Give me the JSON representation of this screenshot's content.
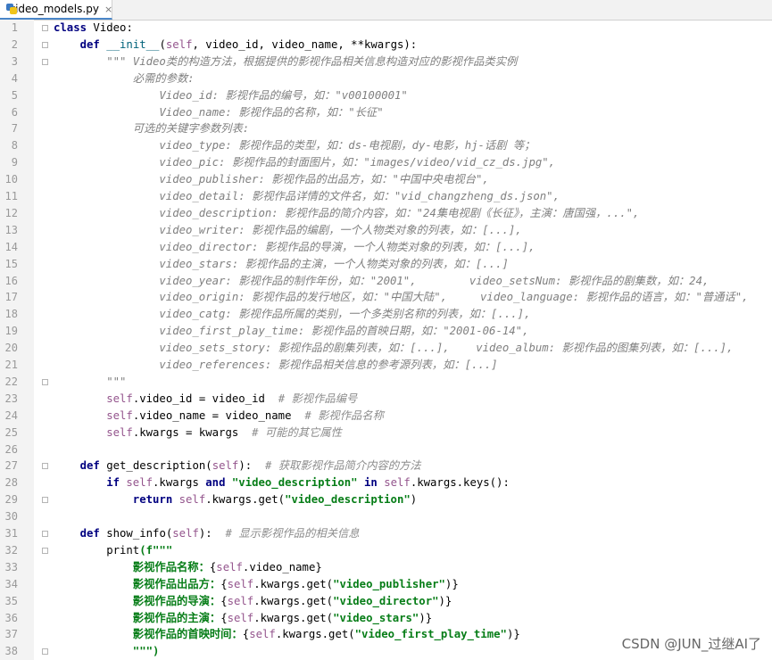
{
  "tab": {
    "filename": "video_models.py",
    "icon": "python-file-icon",
    "close": "×"
  },
  "lines": [
    {
      "n": "1",
      "indent": 0,
      "tokens": [
        {
          "t": "class ",
          "c": "kw"
        },
        {
          "t": "Video:",
          "c": ""
        }
      ]
    },
    {
      "n": "2",
      "indent": 4,
      "tokens": [
        {
          "t": "def ",
          "c": "kw"
        },
        {
          "t": "__init__",
          "c": "fn"
        },
        {
          "t": "(",
          "c": ""
        },
        {
          "t": "self",
          "c": "self"
        },
        {
          "t": ", video_id, video_name, **kwargs):",
          "c": ""
        }
      ]
    },
    {
      "n": "3",
      "indent": 8,
      "tokens": [
        {
          "t": "\"\"\" Video类的构造方法，根据提供的影视作品相关信息构造对应的影视作品类实例",
          "c": "doc"
        }
      ]
    },
    {
      "n": "4",
      "indent": 12,
      "tokens": [
        {
          "t": "必需的参数:",
          "c": "doc"
        }
      ]
    },
    {
      "n": "5",
      "indent": 16,
      "tokens": [
        {
          "t": "Video_id: 影视作品的编号，如：\"v00100001\"",
          "c": "doc"
        }
      ]
    },
    {
      "n": "6",
      "indent": 16,
      "tokens": [
        {
          "t": "Video_name: 影视作品的名称，如：\"长征\"",
          "c": "doc"
        }
      ]
    },
    {
      "n": "7",
      "indent": 12,
      "tokens": [
        {
          "t": "可选的关键字参数列表:",
          "c": "doc"
        }
      ]
    },
    {
      "n": "8",
      "indent": 16,
      "tokens": [
        {
          "t": "video_type: 影视作品的类型，如：ds-电视剧，dy-电影，hj-话剧 等；",
          "c": "doc"
        }
      ]
    },
    {
      "n": "9",
      "indent": 16,
      "tokens": [
        {
          "t": "video_pic: 影视作品的封面图片，如：\"images/video/vid_cz_ds.jpg\",",
          "c": "doc"
        }
      ]
    },
    {
      "n": "10",
      "indent": 16,
      "tokens": [
        {
          "t": "video_publisher: 影视作品的出品方，如：\"中国中央电视台\",",
          "c": "doc"
        }
      ]
    },
    {
      "n": "11",
      "indent": 16,
      "tokens": [
        {
          "t": "video_detail: 影视作品详情的文件名，如：\"vid_changzheng_ds.json\",",
          "c": "doc"
        }
      ]
    },
    {
      "n": "12",
      "indent": 16,
      "tokens": [
        {
          "t": "video_description: 影视作品的简介内容，如：\"24集电视剧《长征》，主演：唐国强，...\",",
          "c": "doc"
        }
      ]
    },
    {
      "n": "13",
      "indent": 16,
      "tokens": [
        {
          "t": "video_writer: 影视作品的编剧，一个人物类对象的列表，如：[...],",
          "c": "doc"
        }
      ]
    },
    {
      "n": "14",
      "indent": 16,
      "tokens": [
        {
          "t": "video_director: 影视作品的导演，一个人物类对象的列表，如：[...],",
          "c": "doc"
        }
      ]
    },
    {
      "n": "15",
      "indent": 16,
      "tokens": [
        {
          "t": "video_stars: 影视作品的主演，一个人物类对象的列表，如：[...]",
          "c": "doc"
        }
      ]
    },
    {
      "n": "16",
      "indent": 16,
      "tokens": [
        {
          "t": "video_year: 影视作品的制作年份，如：\"2001\",        video_setsNum: 影视作品的剧集数，如：24,",
          "c": "doc"
        }
      ]
    },
    {
      "n": "17",
      "indent": 16,
      "tokens": [
        {
          "t": "video_origin: 影视作品的发行地区，如：\"中国大陆\",     video_language: 影视作品的语言，如：\"普通话\",",
          "c": "doc"
        }
      ]
    },
    {
      "n": "18",
      "indent": 16,
      "tokens": [
        {
          "t": "video_catg: 影视作品所属的类别，一个多类别名称的列表，如：[...],",
          "c": "doc"
        }
      ]
    },
    {
      "n": "19",
      "indent": 16,
      "tokens": [
        {
          "t": "video_first_play_time: 影视作品的首映日期，如：\"2001-06-14\",",
          "c": "doc"
        }
      ]
    },
    {
      "n": "20",
      "indent": 16,
      "tokens": [
        {
          "t": "video_sets_story: 影视作品的剧集列表，如：[...],    video_album: 影视作品的图集列表，如：[...],",
          "c": "doc"
        }
      ]
    },
    {
      "n": "21",
      "indent": 16,
      "tokens": [
        {
          "t": "video_references: 影视作品相关信息的参考源列表，如：[...]",
          "c": "doc"
        }
      ]
    },
    {
      "n": "22",
      "indent": 8,
      "tokens": [
        {
          "t": "\"\"\"",
          "c": "doc"
        }
      ]
    },
    {
      "n": "23",
      "indent": 8,
      "tokens": [
        {
          "t": "self",
          "c": "self"
        },
        {
          "t": ".video_id = video_id  ",
          "c": ""
        },
        {
          "t": "# 影视作品编号",
          "c": "cmt"
        }
      ]
    },
    {
      "n": "24",
      "indent": 8,
      "tokens": [
        {
          "t": "self",
          "c": "self"
        },
        {
          "t": ".video_name = video_name  ",
          "c": ""
        },
        {
          "t": "# 影视作品名称",
          "c": "cmt"
        }
      ]
    },
    {
      "n": "25",
      "indent": 8,
      "tokens": [
        {
          "t": "self",
          "c": "self"
        },
        {
          "t": ".kwargs = kwargs  ",
          "c": ""
        },
        {
          "t": "# 可能的其它属性",
          "c": "cmt"
        }
      ]
    },
    {
      "n": "26",
      "indent": 0,
      "tokens": []
    },
    {
      "n": "27",
      "indent": 4,
      "tokens": [
        {
          "t": "def ",
          "c": "kw"
        },
        {
          "t": "get_description",
          "c": ""
        },
        {
          "t": "(",
          "c": ""
        },
        {
          "t": "self",
          "c": "self"
        },
        {
          "t": "):  ",
          "c": ""
        },
        {
          "t": "# 获取影视作品简介内容的方法",
          "c": "cmt"
        }
      ]
    },
    {
      "n": "28",
      "indent": 8,
      "tokens": [
        {
          "t": "if ",
          "c": "kw"
        },
        {
          "t": "self",
          "c": "self"
        },
        {
          "t": ".kwargs ",
          "c": ""
        },
        {
          "t": "and ",
          "c": "kw"
        },
        {
          "t": "\"video_description\"",
          "c": "str"
        },
        {
          "t": " in ",
          "c": "kw"
        },
        {
          "t": "self",
          "c": "self"
        },
        {
          "t": ".kwargs.keys():",
          "c": ""
        }
      ]
    },
    {
      "n": "29",
      "indent": 12,
      "tokens": [
        {
          "t": "return ",
          "c": "kw"
        },
        {
          "t": "self",
          "c": "self"
        },
        {
          "t": ".kwargs.get(",
          "c": ""
        },
        {
          "t": "\"video_description\"",
          "c": "str"
        },
        {
          "t": ")",
          "c": ""
        }
      ]
    },
    {
      "n": "30",
      "indent": 0,
      "tokens": []
    },
    {
      "n": "31",
      "indent": 4,
      "tokens": [
        {
          "t": "def ",
          "c": "kw"
        },
        {
          "t": "show_info",
          "c": ""
        },
        {
          "t": "(",
          "c": ""
        },
        {
          "t": "self",
          "c": "self"
        },
        {
          "t": "):  ",
          "c": ""
        },
        {
          "t": "# 显示影视作品的相关信息",
          "c": "cmt"
        }
      ]
    },
    {
      "n": "32",
      "indent": 8,
      "tokens": [
        {
          "t": "print",
          "c": ""
        },
        {
          "t": "(f\"\"\"",
          "c": "str"
        }
      ]
    },
    {
      "n": "33",
      "indent": 12,
      "tokens": [
        {
          "t": "影视作品名称：",
          "c": "str"
        },
        {
          "t": "{",
          "c": ""
        },
        {
          "t": "self",
          "c": "self"
        },
        {
          "t": ".video_name}",
          "c": ""
        }
      ]
    },
    {
      "n": "34",
      "indent": 12,
      "tokens": [
        {
          "t": "影视作品出品方：",
          "c": "str"
        },
        {
          "t": "{",
          "c": ""
        },
        {
          "t": "self",
          "c": "self"
        },
        {
          "t": ".kwargs.get(",
          "c": ""
        },
        {
          "t": "\"video_publisher\"",
          "c": "str"
        },
        {
          "t": ")}",
          "c": ""
        }
      ]
    },
    {
      "n": "35",
      "indent": 12,
      "tokens": [
        {
          "t": "影视作品的导演：",
          "c": "str"
        },
        {
          "t": "{",
          "c": ""
        },
        {
          "t": "self",
          "c": "self"
        },
        {
          "t": ".kwargs.get(",
          "c": ""
        },
        {
          "t": "\"video_director\"",
          "c": "str"
        },
        {
          "t": ")}",
          "c": ""
        }
      ]
    },
    {
      "n": "36",
      "indent": 12,
      "tokens": [
        {
          "t": "影视作品的主演：",
          "c": "str"
        },
        {
          "t": "{",
          "c": ""
        },
        {
          "t": "self",
          "c": "self"
        },
        {
          "t": ".kwargs.get(",
          "c": ""
        },
        {
          "t": "\"video_stars\"",
          "c": "str"
        },
        {
          "t": ")}",
          "c": ""
        }
      ]
    },
    {
      "n": "37",
      "indent": 12,
      "tokens": [
        {
          "t": "影视作品的首映时间：",
          "c": "str"
        },
        {
          "t": "{",
          "c": ""
        },
        {
          "t": "self",
          "c": "self"
        },
        {
          "t": ".kwargs.get(",
          "c": ""
        },
        {
          "t": "\"video_first_play_time\"",
          "c": "str"
        },
        {
          "t": ")}",
          "c": ""
        }
      ]
    },
    {
      "n": "38",
      "indent": 12,
      "tokens": [
        {
          "t": "\"\"\")",
          "c": "str"
        }
      ]
    }
  ],
  "watermark": "CSDN @JUN_过继AI了"
}
